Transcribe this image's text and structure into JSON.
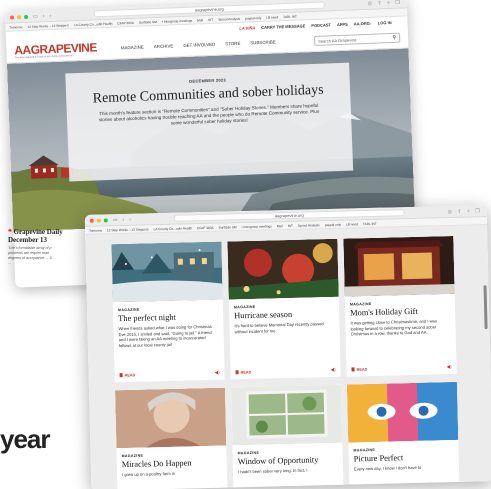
{
  "back_window": {
    "url": "aagrapevine.org",
    "bookmarks": [
      "Tomorow",
      "12 Step Works – 12 Steppers",
      "LA County Co...udio Health",
      "CFAP 360A",
      "SurfSide SM",
      "• Intergroup meetings",
      "Mail",
      "INT",
      "Sprout Analysis",
      "paypal only",
      "LB need",
      "TARL INT"
    ],
    "topnav": {
      "lavina": "LA VIÑA",
      "items": [
        "CARRY THE MESSAGE",
        "PODCAST",
        "APPS",
        "AA.ORG↑",
        "LOG IN"
      ]
    },
    "logo": {
      "aa": "AA",
      "grapevine": "GRAPEVINE",
      "tagline": "The International Journal of Alcoholics Anonymous"
    },
    "nav": [
      "MAGAZINE",
      "ARCHIVE",
      "GET INVOLVED",
      "STORE",
      "SUBSCRIBE"
    ],
    "search_placeholder": "Search AA Grapevine",
    "hero": {
      "date": "DECEMBER 2023",
      "title": "Remote Communities and sober holidays",
      "description": "This month's feature section is \"Remote Communities\" and \"Sober Holiday Stories.\" Members share hopeful stories about alcoholics having trouble reaching AA and the people who do Remote Community service. Plus some wonderful sober holiday stories!"
    },
    "daily": {
      "quote_mark": "❝",
      "title": "Grapevine Daily",
      "date": "December 13",
      "text_lines": [
        "\"Life's formidable array of p",
        "problems will require man",
        "degrees of acceptance ... S",
        "..."
      ]
    }
  },
  "front_window": {
    "url": "aagrapevine.org",
    "bookmarks": [
      "Tomorow",
      "12 Step Works – 12 Steppers",
      "LA County Co...udio Health",
      "CFAP 360A",
      "SurfSide SM",
      "• Intergroup meetings",
      "Mail",
      "INT",
      "Sprout Analysis",
      "paypal only",
      "LB need",
      "TARL INT"
    ],
    "cards": [
      {
        "type": "MAGAZINE",
        "title": "The perfect night",
        "desc": "When friends asked what I was doing for Christmas Eve 2015, I smiled and said, \"Going to jail.\" A friend and I were taking an AA meeting to incarcerated fellows at our local county jail",
        "read": "READ",
        "speaker_icon": "speaker-icon"
      },
      {
        "type": "MAGAZINE",
        "title": "Hurricane season",
        "desc": "It's hard to believe Memorial Day recently passed without incident for me.",
        "read": "READ",
        "speaker_icon": "speaker-icon"
      },
      {
        "type": "MAGAZINE",
        "title": "Mom's Holiday Gift",
        "desc": "It was getting close to Christmastime, and I was looking forward to celebrating my second sober Christmas in a row, thanks to God and AA.",
        "read": "READ",
        "speaker_icon": "speaker-icon"
      },
      {
        "type": "MAGAZINE",
        "title": "Miracles Do Happen",
        "desc": "I grew up on a poultry farm in",
        "read": "",
        "speaker_icon": ""
      },
      {
        "type": "MAGAZINE",
        "title": "Window of Opportunity",
        "desc": "I hadn't been sober very long. In fact, I",
        "read": "",
        "speaker_icon": ""
      },
      {
        "type": "MAGAZINE",
        "title": "Picture Perfect",
        "desc": "Every new day, I know I don't have to",
        "read": "",
        "speaker_icon": ""
      }
    ]
  },
  "background_text": "year",
  "colors": {
    "brand_red": "#c0392b",
    "dark_text": "#222222"
  }
}
